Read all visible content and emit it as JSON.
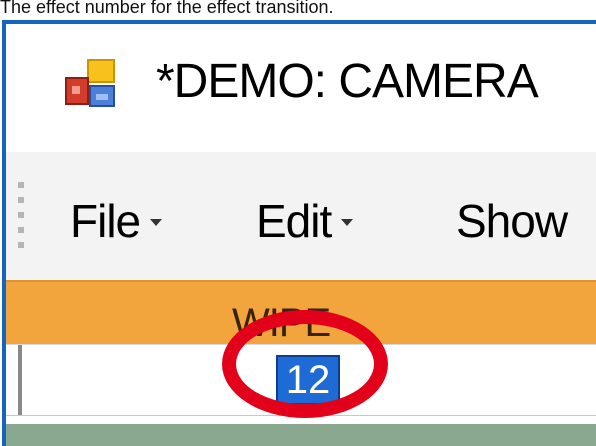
{
  "caption": "The effect number for the effect transition.",
  "window": {
    "title": "*DEMO: CAMERA"
  },
  "menu": {
    "items": [
      {
        "label": "File"
      },
      {
        "label": "Edit"
      },
      {
        "label": "Show"
      }
    ]
  },
  "grid": {
    "column_header": "WIPE",
    "cell_value": "12"
  },
  "colors": {
    "window_border": "#1565c0",
    "column_header_bg": "#f2a53c",
    "selection": "#1e6bd6",
    "highlight_ring": "#e3001b"
  }
}
